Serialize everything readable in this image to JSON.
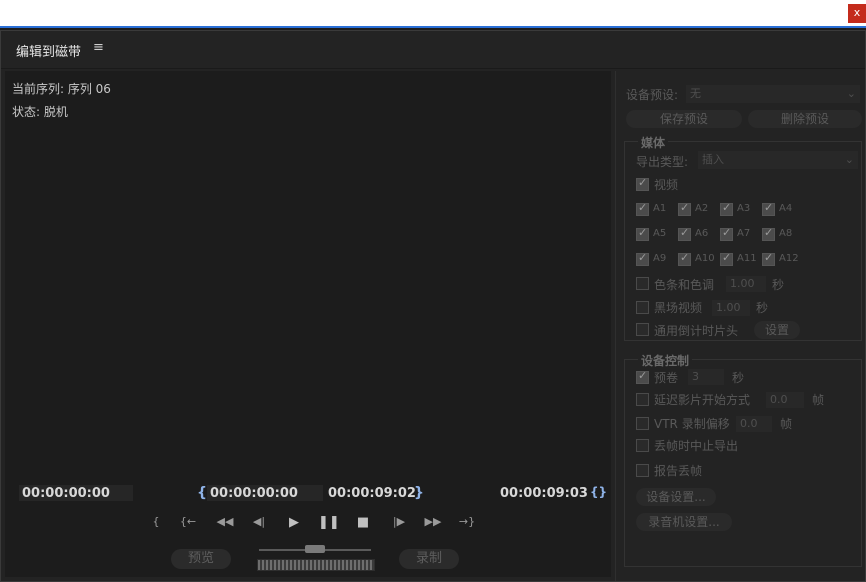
{
  "window": {
    "close_label": "x"
  },
  "panel": {
    "title": "编辑到磁带",
    "menu_icon": "≡"
  },
  "monitor": {
    "sequence_label": "当前序列: 序列 06",
    "status_label": "状态: 脱机",
    "timecodes": {
      "current": "00:00:00:00",
      "in_point": "00:00:00:00",
      "out_point": "00:00:09:02",
      "duration": "00:00:09:03"
    },
    "brace_in": "{",
    "brace_out": "}",
    "brace_both": "{}",
    "controls": [
      {
        "name": "mark-in",
        "glyph": "{"
      },
      {
        "name": "go-to-in",
        "glyph": "{←"
      },
      {
        "name": "rewind",
        "glyph": "◀◀"
      },
      {
        "name": "step-back",
        "glyph": "◀|"
      },
      {
        "name": "play",
        "glyph": "▶"
      },
      {
        "name": "pause",
        "glyph": "❚❚"
      },
      {
        "name": "stop",
        "glyph": "■"
      },
      {
        "name": "step-forward",
        "glyph": "|▶"
      },
      {
        "name": "fast-forward",
        "glyph": "▶▶"
      },
      {
        "name": "go-to-out",
        "glyph": "→}"
      }
    ],
    "preview_label": "预览",
    "record_label": "录制"
  },
  "settings": {
    "device_preset_label": "设备预设:",
    "device_preset_value": "无",
    "save_preset": "保存预设",
    "delete_preset": "删除预设",
    "media": {
      "title": "媒体",
      "export_type_label": "导出类型:",
      "export_type_value": "插入",
      "video_label": "视频",
      "audio_tracks": [
        "A1",
        "A2",
        "A3",
        "A4",
        "A5",
        "A6",
        "A7",
        "A8",
        "A9",
        "A10",
        "A11",
        "A12"
      ],
      "color_bars_label": "色条和色调",
      "color_bars_value": "1.00",
      "black_video_label": "黑场视频",
      "black_video_value": "1.00",
      "seconds_unit": "秒",
      "countdown_label": "通用倒计时片头",
      "countdown_settings": "设置"
    },
    "device_control": {
      "title": "设备控制",
      "preroll_label": "预卷",
      "preroll_value": "3",
      "seconds_unit": "秒",
      "delay_label": "延迟影片开始方式",
      "delay_value": "0.0",
      "frames_unit": "帧",
      "vtr_label": "VTR 录制偏移",
      "vtr_value": "0.0",
      "abort_label": "丢帧时中止导出",
      "report_label": "报告丢帧",
      "device_settings": "设备设置...",
      "recorder_settings": "录音机设置..."
    }
  }
}
